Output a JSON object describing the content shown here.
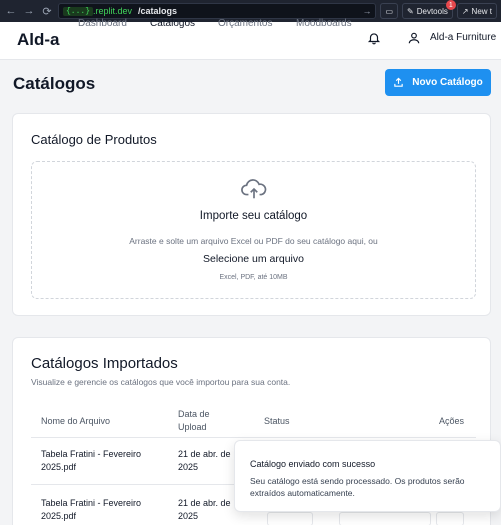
{
  "browser": {
    "url_chip": "{...}",
    "url_host": ".replit.dev",
    "url_path": "/catalogs",
    "devtools_label": "Devtools",
    "devtools_badge": "1",
    "new_tab_label": "New t"
  },
  "header": {
    "logo": "Ald-a",
    "nav": [
      "Dashboard",
      "Catálogos",
      "Orçamentos",
      "Moodboards"
    ],
    "user_name": "Ald-a Furniture"
  },
  "page": {
    "title": "Catálogos",
    "new_button": "Novo Catálogo"
  },
  "upload_card": {
    "title": "Catálogo de Produtos",
    "heading": "Importe seu catálogo",
    "subtext": "Arraste e solte um arquivo Excel ou PDF do seu catálogo aqui, ou",
    "link": "Selecione um arquivo",
    "hint": "Excel, PDF, até 10MB"
  },
  "imported_card": {
    "title": "Catálogos Importados",
    "description": "Visualize e gerencie os catálogos que você importou para sua conta.",
    "columns": {
      "name": "Nome do Arquivo",
      "date_line1": "Data de",
      "date_line2": "Upload",
      "status": "Status",
      "actions": "Ações"
    },
    "rows": [
      {
        "name_line1": "Tabela Fratini - Fevereiro",
        "name_line2": "2025.pdf",
        "date_line1": "21 de abr. de",
        "date_line2": "2025"
      },
      {
        "name_line1": "Tabela Fratini - Fevereiro",
        "name_line2": "2025.pdf",
        "date_line1": "21 de abr. de",
        "date_line2": "2025"
      }
    ]
  },
  "toast": {
    "title": "Catálogo enviado com sucesso",
    "body": "Seu catálogo está sendo processado. Os produtos serão extraídos automaticamente."
  }
}
